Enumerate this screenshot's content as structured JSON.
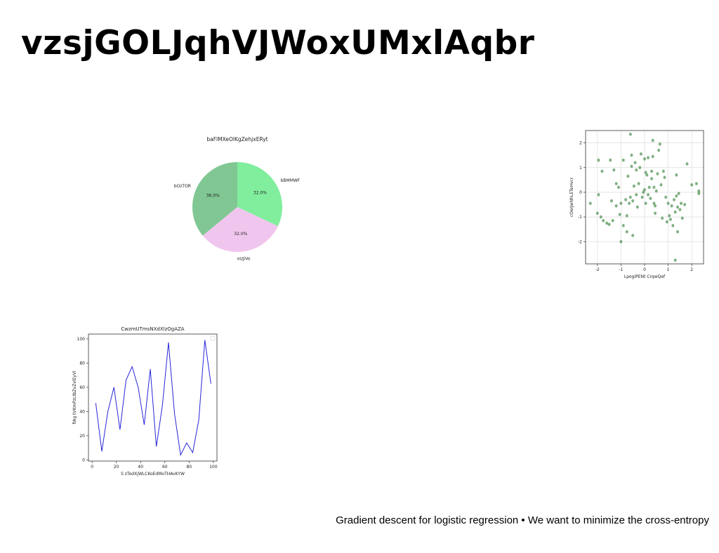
{
  "slide": {
    "title": "vzsjGOLJqhVJWoxUMxlAqbr",
    "footer": "Gradient descent for logistic regression • We want to minimize the cross-entropy"
  },
  "chart_data": [
    {
      "type": "pie",
      "title": "baFlMXeOlKgZehjxERyt",
      "slices": [
        {
          "label": "bBMMWF",
          "value": 32.0,
          "pct_label": "32.0%",
          "color": "#81ee9e"
        },
        {
          "label": "oUJiVo",
          "value": 32.0,
          "pct_label": "32.0%",
          "color": "#f0c6ee"
        },
        {
          "label": "bOzTOR",
          "value": 36.0,
          "pct_label": "36.0%",
          "color": "#80c794"
        }
      ],
      "start_angle_deg": 90,
      "direction": "clockwise"
    },
    {
      "type": "scatter",
      "xlabel": "LpogiPENt CrqwQef",
      "ylabel": "cOerjwNhLETeHvcr",
      "xlim": [
        -2.5,
        2.5
      ],
      "ylim": [
        -2.9,
        2.5
      ],
      "xticks": [
        -2,
        -1,
        0,
        1,
        2
      ],
      "yticks": [
        -2,
        -1,
        0,
        1,
        2
      ],
      "grid": true,
      "color": "#2e7d32",
      "points": [
        [
          -2.3,
          -0.45
        ],
        [
          -2.0,
          -0.85
        ],
        [
          -1.95,
          -0.1
        ],
        [
          -1.95,
          1.3
        ],
        [
          -1.85,
          -1.0
        ],
        [
          -1.8,
          0.85
        ],
        [
          -1.75,
          -1.15
        ],
        [
          -1.6,
          -1.25
        ],
        [
          -1.5,
          -1.3
        ],
        [
          -1.45,
          1.3
        ],
        [
          -1.4,
          -0.35
        ],
        [
          -1.35,
          -1.15
        ],
        [
          -1.3,
          0.9
        ],
        [
          -1.2,
          -0.55
        ],
        [
          -1.2,
          0.35
        ],
        [
          -1.1,
          0.2
        ],
        [
          -1.05,
          -0.9
        ],
        [
          -1.0,
          -2.0
        ],
        [
          -1.0,
          -0.45
        ],
        [
          -0.9,
          -1.35
        ],
        [
          -0.9,
          1.3
        ],
        [
          -0.8,
          -0.3
        ],
        [
          -0.75,
          -1.6
        ],
        [
          -0.75,
          -0.95
        ],
        [
          -0.7,
          0.65
        ],
        [
          -0.65,
          -0.45
        ],
        [
          -0.6,
          2.35
        ],
        [
          -0.6,
          -0.2
        ],
        [
          -0.55,
          1.05
        ],
        [
          -0.55,
          1.5
        ],
        [
          -0.5,
          -0.35
        ],
        [
          -0.5,
          -1.75
        ],
        [
          -0.45,
          0.25
        ],
        [
          -0.4,
          1.2
        ],
        [
          -0.35,
          -0.1
        ],
        [
          -0.35,
          0.9
        ],
        [
          -0.3,
          -0.6
        ],
        [
          -0.25,
          0.35
        ],
        [
          -0.2,
          1.0
        ],
        [
          -0.15,
          1.55
        ],
        [
          -0.1,
          -0.2
        ],
        [
          -0.05,
          0.0
        ],
        [
          0.0,
          1.35
        ],
        [
          0.0,
          0.1
        ],
        [
          0.05,
          0.8
        ],
        [
          0.05,
          -0.45
        ],
        [
          0.1,
          0.7
        ],
        [
          0.15,
          1.4
        ],
        [
          0.15,
          -0.1
        ],
        [
          0.2,
          0.2
        ],
        [
          0.25,
          -0.25
        ],
        [
          0.3,
          0.55
        ],
        [
          0.3,
          0.85
        ],
        [
          0.35,
          2.1
        ],
        [
          0.35,
          1.45
        ],
        [
          0.4,
          -0.45
        ],
        [
          0.4,
          0.2
        ],
        [
          0.45,
          -0.55
        ],
        [
          0.45,
          -0.85
        ],
        [
          0.5,
          0.05
        ],
        [
          0.55,
          0.75
        ],
        [
          0.6,
          1.7
        ],
        [
          0.65,
          1.95
        ],
        [
          0.7,
          0.3
        ],
        [
          0.75,
          -1.05
        ],
        [
          0.8,
          0.85
        ],
        [
          0.85,
          0.6
        ],
        [
          0.9,
          -0.2
        ],
        [
          0.95,
          -1.2
        ],
        [
          1.0,
          -0.45
        ],
        [
          1.05,
          -0.95
        ],
        [
          1.1,
          -1.1
        ],
        [
          1.15,
          -0.55
        ],
        [
          1.2,
          -1.35
        ],
        [
          1.25,
          -0.3
        ],
        [
          1.3,
          -0.8
        ],
        [
          1.3,
          -2.75
        ],
        [
          1.35,
          0.7
        ],
        [
          1.35,
          -0.15
        ],
        [
          1.4,
          -1.6
        ],
        [
          1.4,
          -0.6
        ],
        [
          1.45,
          -0.05
        ],
        [
          1.5,
          -0.7
        ],
        [
          1.55,
          -0.45
        ],
        [
          1.6,
          -1.05
        ],
        [
          1.7,
          -0.5
        ],
        [
          1.8,
          1.15
        ],
        [
          2.0,
          0.3
        ],
        [
          2.2,
          0.35
        ],
        [
          2.3,
          0.05
        ],
        [
          2.3,
          -0.05
        ]
      ]
    },
    {
      "type": "line",
      "title": "CwzmUTmsNXdXlzOgAZA",
      "xlabel": "S zTodXjWLCKoEdMoTHAvKYW",
      "ylabel": "fIAg tVKmPzLtbZvZvlEyVl",
      "xlim": [
        -3,
        103
      ],
      "ylim": [
        -1,
        104
      ],
      "xticks": [
        0,
        20,
        40,
        60,
        80,
        100
      ],
      "yticks": [
        0,
        20,
        40,
        60,
        80,
        100
      ],
      "color": "#2626d9",
      "x": [
        3,
        8,
        13,
        18,
        23,
        28,
        33,
        38,
        43,
        48,
        53,
        58,
        63,
        68,
        73,
        78,
        83,
        88,
        93,
        98
      ],
      "y": [
        47,
        7,
        40,
        60,
        25,
        66,
        77,
        60,
        29,
        75,
        11,
        45,
        97,
        38,
        4,
        14,
        6,
        33,
        99,
        63
      ]
    }
  ]
}
